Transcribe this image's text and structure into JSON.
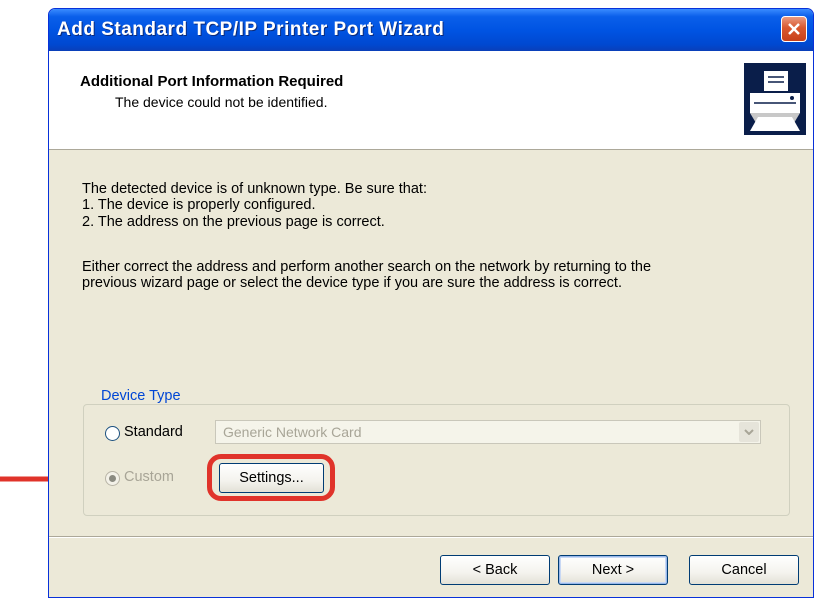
{
  "window": {
    "title": "Add Standard TCP/IP Printer Port Wizard",
    "close_glyph": "✕"
  },
  "header": {
    "title": "Additional Port Information Required",
    "subtitle": "The device could not be identified.",
    "icon": "printer-icon"
  },
  "body": {
    "line1": "The detected device is of unknown type.  Be sure that:",
    "line2": "1.  The device is properly configured.",
    "line3": "2.  The address on the previous page is correct.",
    "para2_line1": "Either correct the address and perform another search on the network by returning to the",
    "para2_line2": "previous wizard page or select the device type if you are sure the address is correct."
  },
  "device_type": {
    "label": "Device Type",
    "standard_label": "Standard",
    "standard_value": "Generic Network Card",
    "custom_label": "Custom",
    "settings_label": "Settings..."
  },
  "footer": {
    "back_label": "< Back",
    "next_label": "Next >",
    "cancel_label": "Cancel"
  },
  "colors": {
    "titlebar": "#0054E3",
    "face": "#ECE9D8",
    "highlight": "#E0332A",
    "group_label": "#0046D5"
  }
}
